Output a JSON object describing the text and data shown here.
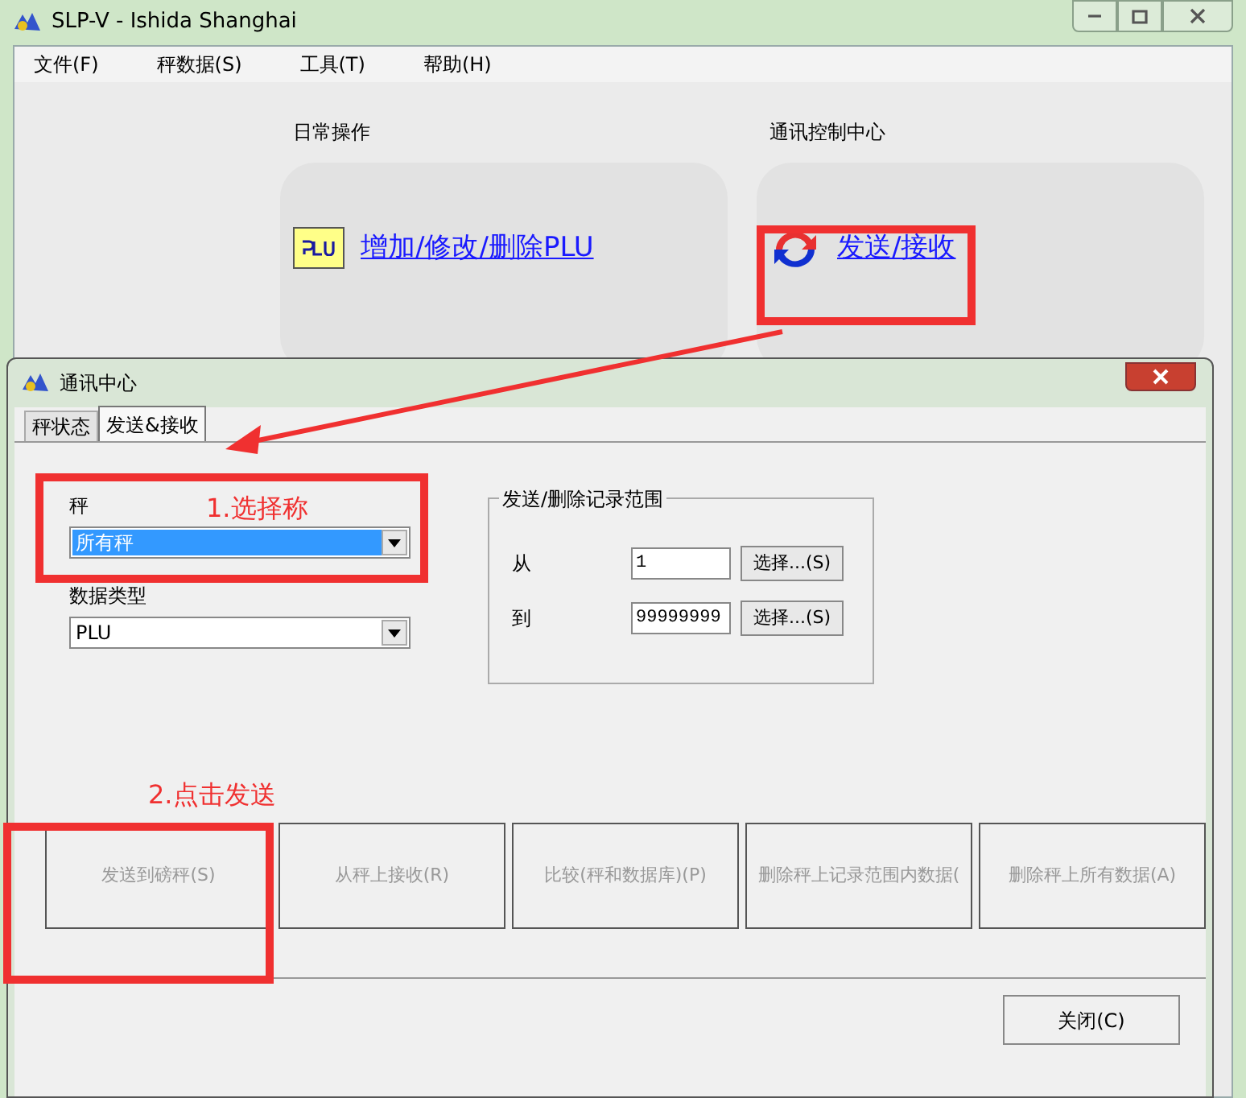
{
  "window": {
    "title": "SLP-V - Ishida Shanghai"
  },
  "menu": [
    {
      "label": "文件(F)"
    },
    {
      "label": "秤数据(S)"
    },
    {
      "label": "工具(T)"
    },
    {
      "label": "帮助(H)"
    }
  ],
  "sections": [
    {
      "heading": "日常操作",
      "link": "增加/修改/删除PLU",
      "kind": "plu"
    },
    {
      "heading": "通讯控制中心",
      "link": "发送/接收",
      "kind": "sync"
    }
  ],
  "dialog": {
    "title": "通讯中心",
    "tabs": [
      {
        "label": "秤状态",
        "selected": false
      },
      {
        "label": "发送&接收",
        "selected": true
      }
    ],
    "scale": {
      "label": "秤",
      "value": "所有秤",
      "focused": true
    },
    "data_type": {
      "label": "数据类型",
      "value": "PLU",
      "focused": false
    },
    "range": {
      "title": "发送/删除记录范围",
      "rows": [
        {
          "label": "从",
          "value": "1",
          "button": "选择...(S)"
        },
        {
          "label": "到",
          "value": "99999999",
          "button": "选择...(S)"
        }
      ]
    },
    "actions": [
      {
        "label": "发送到磅秤(S)",
        "disabled": true
      },
      {
        "label": "从秤上接收(R)",
        "disabled": true
      },
      {
        "label": "比较(秤和数据库)(P)",
        "disabled": true
      },
      {
        "label": "删除秤上记录范围内数据(",
        "disabled": true
      },
      {
        "label": "删除秤上所有数据(A)",
        "disabled": true
      }
    ],
    "close": "关闭(C)"
  },
  "annotations": [
    {
      "text": "1.选择称"
    },
    {
      "text": "2.点击发送"
    }
  ]
}
